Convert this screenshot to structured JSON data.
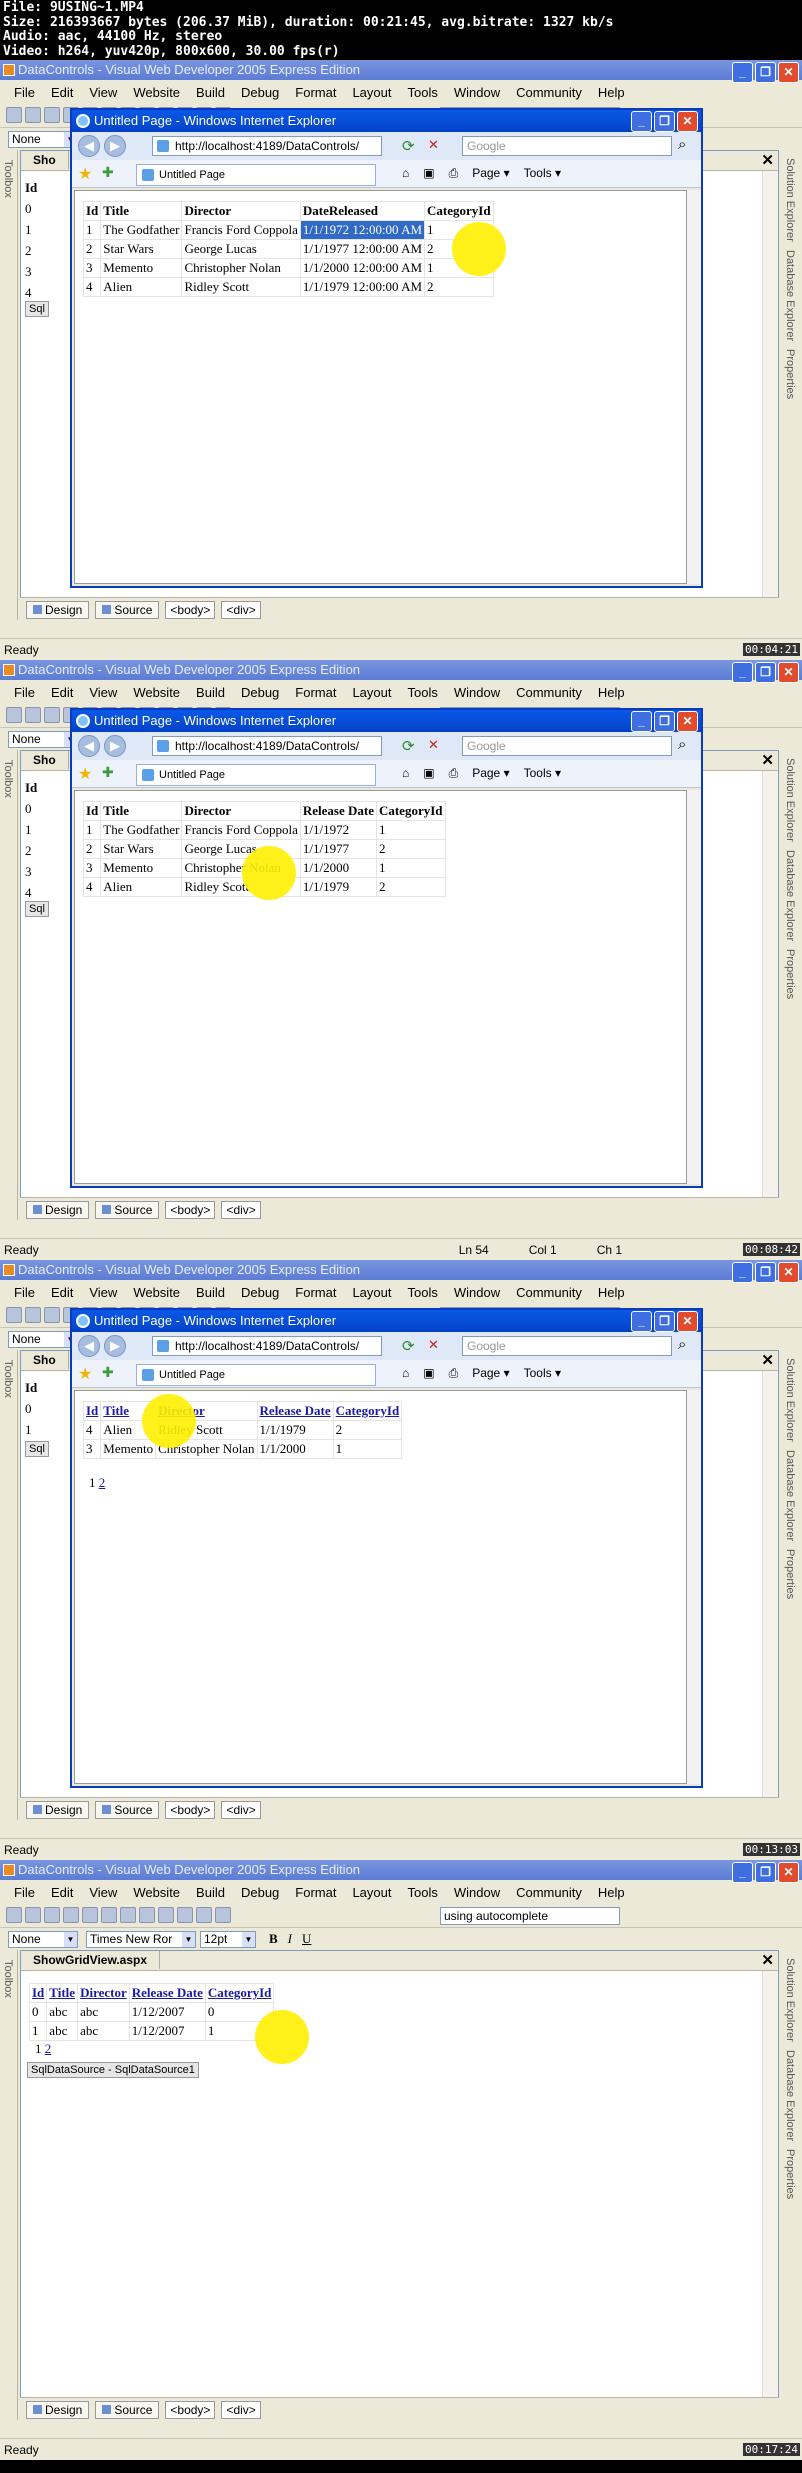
{
  "header": {
    "line1": "File: 9USING~1.MP4",
    "line2": "Size: 216393667 bytes (206.37 MiB), duration: 00:21:45, avg.bitrate: 1327 kb/s",
    "line3": "Audio: aac, 44100 Hz, stereo",
    "line4": "Video: h264, yuv420p, 800x600, 30.00 fps(r)"
  },
  "app": {
    "title": "DataControls - Visual Web Developer 2005 Express Edition",
    "menu": [
      "File",
      "Edit",
      "View",
      "Website",
      "Build",
      "Debug",
      "Format",
      "Layout",
      "Tools",
      "Window",
      "Community",
      "Help"
    ],
    "autocomplete": "using autocomplete",
    "block_format": "None",
    "font_name": "Times New Ror",
    "font_size": "12pt",
    "toolbox": "Toolbox",
    "solution_explorer": "Solution Explorer",
    "database_explorer": "Database Explorer",
    "properties": "Properties",
    "design_tab": "Design",
    "source_tab": "Source",
    "tag_body": "<body>",
    "tag_div": "<div>",
    "status_ready": "Ready",
    "doc_tab": "ShowGridView.aspx"
  },
  "ie": {
    "title": "Untitled Page - Windows Internet Explorer",
    "url": "http://localhost:4189/DataControls/",
    "search_placeholder": "Google",
    "page_tab": "Untitled Page",
    "page_menu": "Page",
    "tools_menu": "Tools"
  },
  "frames": [
    {
      "stamp": "00:04:21",
      "status_extra": [
        "",
        "",
        ""
      ],
      "grid": {
        "headers": [
          "Id",
          "Title",
          "Director",
          "DateReleased",
          "CategoryId"
        ],
        "rows": [
          [
            "1",
            "The Godfather",
            "Francis Ford Coppola",
            "1/1/1972 12:00:00 AM",
            "1"
          ],
          [
            "2",
            "Star Wars",
            "George Lucas",
            "1/1/1977 12:00:00 AM",
            "2"
          ],
          [
            "3",
            "Memento",
            "Christopher Nolan",
            "1/1/2000 12:00:00 AM",
            "1"
          ],
          [
            "4",
            "Alien",
            "Ridley Scott",
            "1/1/1979 12:00:00 AM",
            "2"
          ]
        ]
      }
    },
    {
      "stamp": "00:08:42",
      "status_extra": [
        "Ln 54",
        "Col 1",
        "Ch 1"
      ],
      "grid": {
        "headers": [
          "Id",
          "Title",
          "Director",
          "Release Date",
          "CategoryId"
        ],
        "rows": [
          [
            "1",
            "The Godfather",
            "Francis Ford Coppola",
            "1/1/1972",
            "1"
          ],
          [
            "2",
            "Star Wars",
            "George Lucas",
            "1/1/1977",
            "2"
          ],
          [
            "3",
            "Memento",
            "Christopher Nolan",
            "1/1/2000",
            "1"
          ],
          [
            "4",
            "Alien",
            "Ridley Scott",
            "1/1/1979",
            "2"
          ]
        ]
      }
    },
    {
      "stamp": "00:13:03",
      "status_extra": [
        "",
        "",
        ""
      ],
      "grid": {
        "headers": [
          "Id",
          "Title",
          "Director",
          "Release Date",
          "CategoryId"
        ],
        "rows": [
          [
            "4",
            "Alien",
            "Ridley Scott",
            "1/1/1979",
            "2"
          ],
          [
            "3",
            "Memento",
            "Christopher Nolan",
            "1/1/2000",
            "1"
          ]
        ],
        "pager": [
          "1",
          "2"
        ]
      }
    },
    {
      "stamp": "00:17:24",
      "status_extra": [
        "",
        "",
        ""
      ],
      "grid": {
        "headers": [
          "Id",
          "Title",
          "Director",
          "Release Date",
          "CategoryId"
        ],
        "rows": [
          [
            "0",
            "abc",
            "abc",
            "1/12/2007",
            "0"
          ],
          [
            "1",
            "abc",
            "abc",
            "1/12/2007",
            "1"
          ]
        ],
        "pager": [
          "1",
          "2"
        ],
        "datasource": "SqlDataSource - SqlDataSource1"
      }
    }
  ]
}
